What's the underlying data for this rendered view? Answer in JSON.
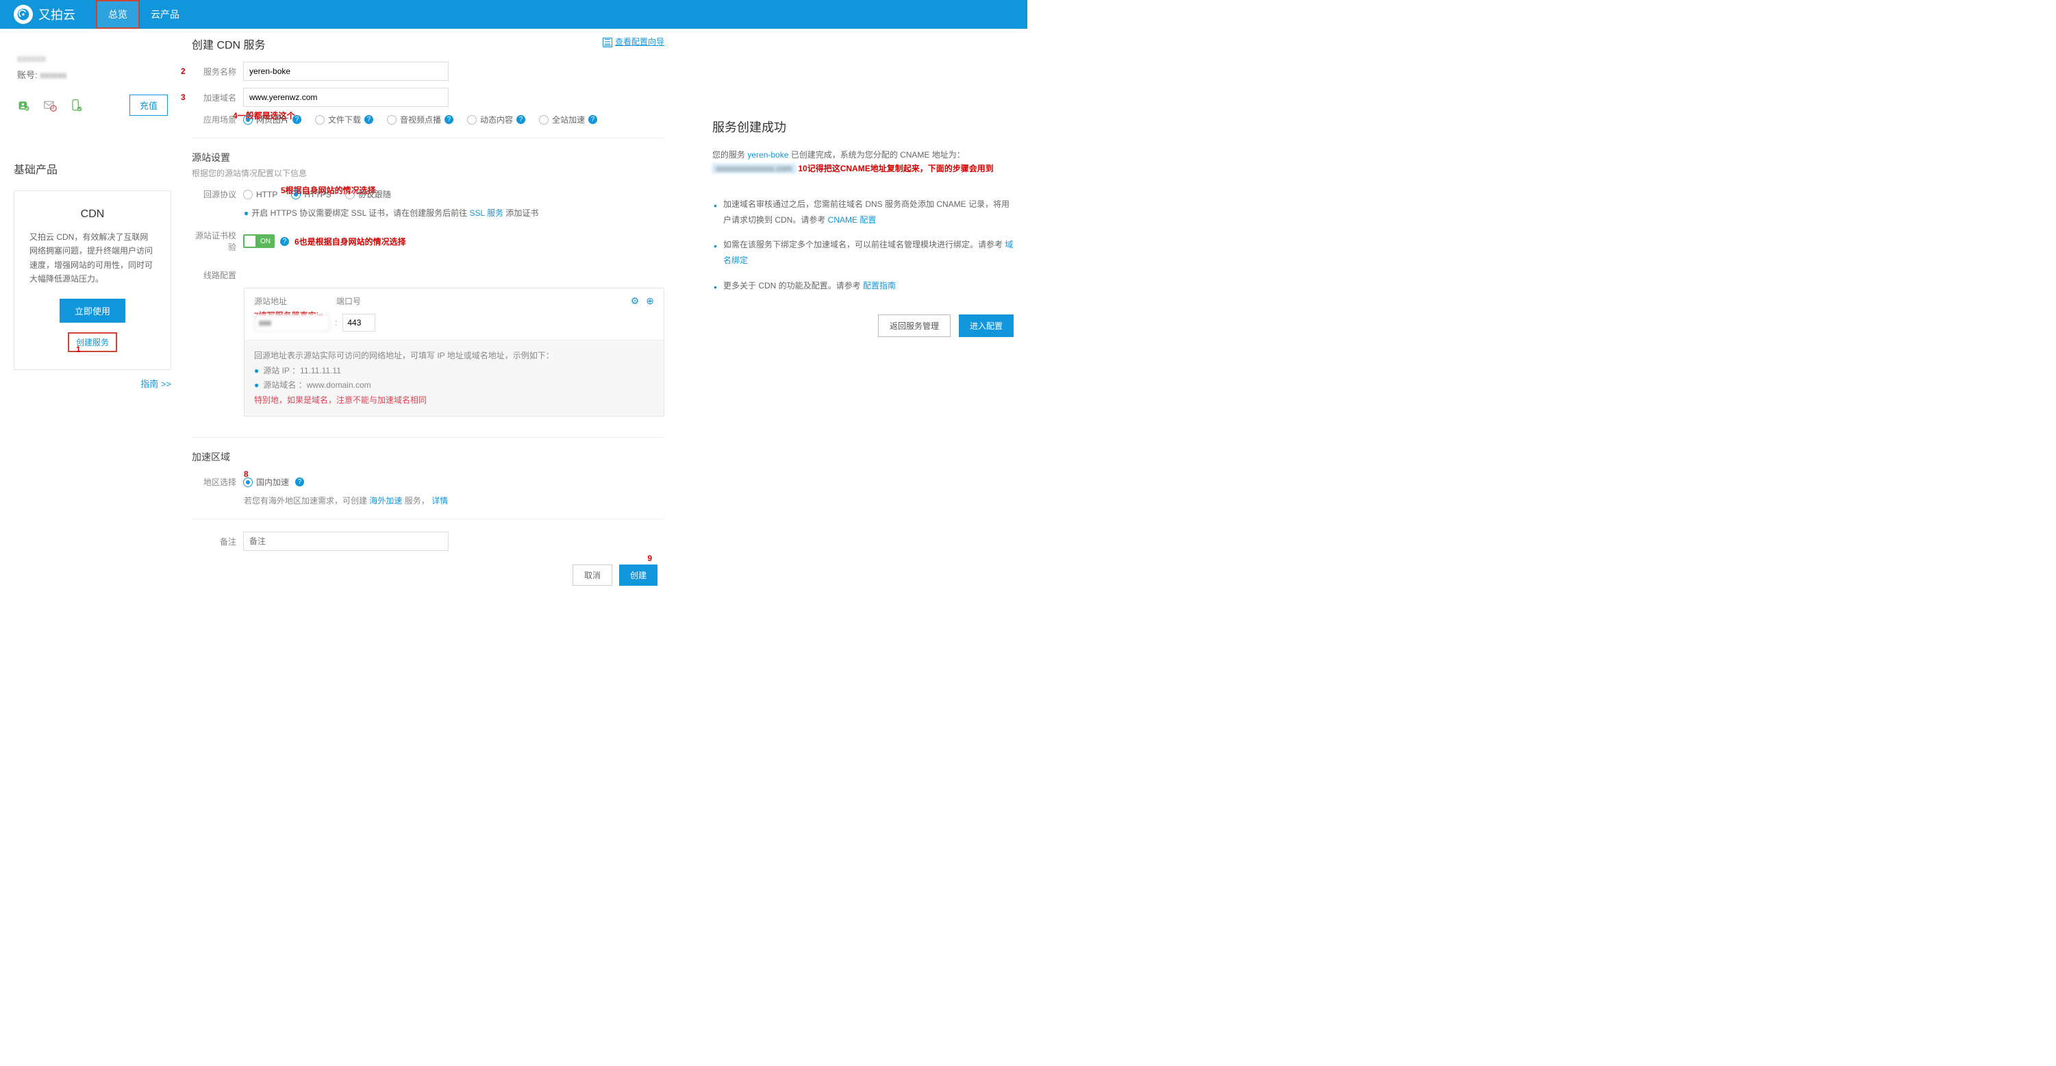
{
  "topbar": {
    "brand": "又拍云",
    "nav": {
      "overview": "总览",
      "cloud_products": "云产品"
    }
  },
  "sidebar": {
    "account_name": "xxxxxx",
    "account_label": "账号:",
    "account_id_mask": "xxxxxx",
    "recharge": "充值",
    "base_products": "基础产品",
    "cdn": {
      "title": "CDN",
      "desc": "又拍云 CDN，有效解决了互联网网络拥塞问题，提升终端用户访问速度，增强网站的可用性，同时可大幅降低源站压力。",
      "use_now": "立即使用",
      "create_service": "创建服务",
      "guide": "指南 >>"
    },
    "ann": {
      "one": "1"
    }
  },
  "main": {
    "title": "创建 CDN 服务",
    "wizard": "查看配置向导",
    "service_name": {
      "label": "服务名称",
      "value": "yeren-boke",
      "ann": "2"
    },
    "domain": {
      "label": "加速域名",
      "value": "www.yerenwz.com",
      "ann": "3"
    },
    "scenario": {
      "label": "应用场景",
      "ann": "4一般都是选这个",
      "options": {
        "web": "网页图片",
        "download": "文件下载",
        "video": "音视频点播",
        "dynamic": "动态内容",
        "whole": "全站加速"
      }
    },
    "origin": {
      "title": "源站设置",
      "hint": "根据您的源站情况配置以下信息",
      "protocol": {
        "label": "回源协议",
        "ann": "5根据自身网站的情况选择",
        "http": "HTTP",
        "https": "HTTPS",
        "follow": "协议跟随",
        "note_pre": "开启 HTTPS 协议需要绑定 SSL 证书，请在创建服务后前往 ",
        "note_link": "SSL 服务",
        "note_post": " 添加证书"
      },
      "cert_check": {
        "label": "源站证书校验",
        "toggle": "ON",
        "ann": "6也是根据自身网站的情况选择"
      },
      "line": {
        "label": "线路配置",
        "col_addr": "源站地址",
        "col_port": "端口号",
        "ann": "7填写服务器真实ip",
        "port": "443",
        "help_line1": "回源地址表示源站实际可访问的网络地址，可填写 IP 地址或域名地址，示例如下：",
        "help_ip": "源站 IP ：11.11.11.11",
        "help_domain": "源站域名 ：www.domain.com",
        "help_warn": "特别地，如果是域名，注意不能与加速域名相同"
      }
    },
    "region": {
      "title": "加速区域",
      "label": "地区选择",
      "ann": "8",
      "domestic": "国内加速",
      "note_pre": "若您有海外地区加速需求，可创建 ",
      "note_link1": "海外加速",
      "note_mid": " 服务，",
      "note_link2": "详情"
    },
    "remark": {
      "label": "备注",
      "placeholder": "备注"
    },
    "actions": {
      "cancel": "取消",
      "create": "创建",
      "ann": "9"
    }
  },
  "right": {
    "title": "服务创建成功",
    "p1_pre": "您的服务 ",
    "p1_svc": "yeren-boke",
    "p1_mid": " 已创建完成，系统为您分配的 CNAME 地址为：",
    "p1_cname_mask": "xxxxxxxxxxxxxx.com",
    "ann10": "10记得把这CNAME地址复制起来，下面的步骤会用到",
    "li1_pre": "加速域名审核通过之后，您需前往域名 DNS 服务商处添加 CNAME 记录，将用户请求切换到 CDN。请参考 ",
    "li1_link": "CNAME 配置",
    "li2_pre": "如需在该服务下绑定多个加速域名，可以前往域名管理模块进行绑定。请参考",
    "li2_link": "域名绑定",
    "li3_pre": "更多关于 CDN 的功能及配置。请参考",
    "li3_link": "配置指南",
    "back": "返回服务管理",
    "config": "进入配置"
  }
}
